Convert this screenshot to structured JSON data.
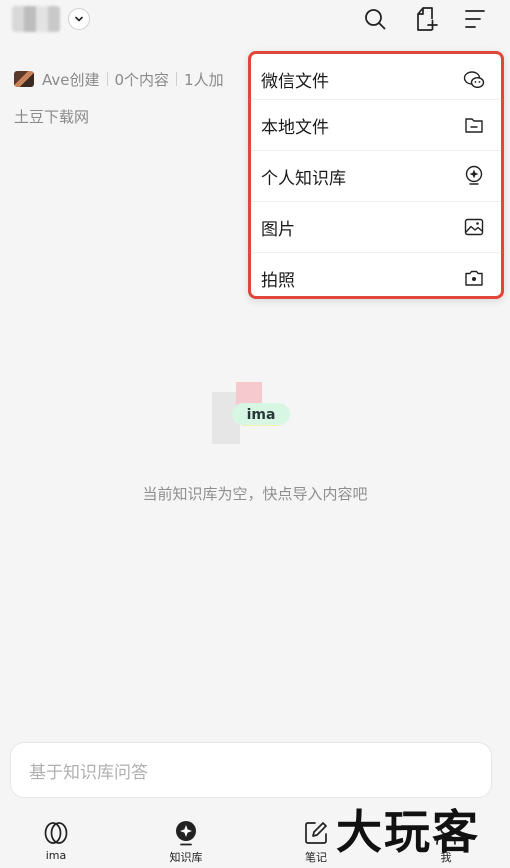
{
  "header": {
    "icons": [
      "chevron-down-icon",
      "search-icon",
      "add-file-icon",
      "menu-icon"
    ]
  },
  "meta": {
    "creator": "Ave创建",
    "content_count": "0个内容",
    "members": "1人加"
  },
  "source_label": "土豆下载网",
  "import_menu": {
    "items": [
      {
        "label": "微信文件",
        "icon": "wechat-icon"
      },
      {
        "label": "本地文件",
        "icon": "folder-icon"
      },
      {
        "label": "个人知识库",
        "icon": "knowledge-base-icon"
      },
      {
        "label": "图片",
        "icon": "image-icon"
      },
      {
        "label": "拍照",
        "icon": "camera-icon"
      }
    ]
  },
  "empty_state": {
    "logo_text": "ima",
    "message": "当前知识库为空，快点导入内容吧"
  },
  "ask": {
    "placeholder": "基于知识库问答"
  },
  "bottom_nav": {
    "items": [
      {
        "label": "ima",
        "icon": "ima-icon"
      },
      {
        "label": "知识库",
        "icon": "knowledge-icon"
      },
      {
        "label": "笔记",
        "icon": "note-icon"
      },
      {
        "label": "我",
        "icon": "user-icon"
      }
    ]
  },
  "watermark": "大玩客"
}
